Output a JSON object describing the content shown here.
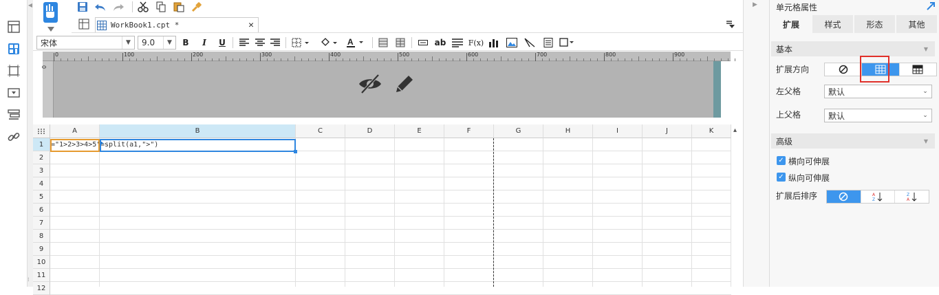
{
  "document": {
    "tab_label": "WorkBook1.cpt *"
  },
  "format": {
    "font_name": "宋体",
    "font_size": "9.0"
  },
  "format_buttons": {
    "bold": "B",
    "italic": "I",
    "underline": "U",
    "text_ab": "ab",
    "formula": "F(x)"
  },
  "ruler": {
    "ticks": [
      "0",
      "100",
      "200",
      "300",
      "400",
      "500",
      "600",
      "700",
      "800",
      "900"
    ],
    "vtick": "0"
  },
  "grid": {
    "columns": [
      "A",
      "B",
      "C",
      "D",
      "E",
      "F",
      "G",
      "H",
      "I",
      "J",
      "K"
    ],
    "rows": [
      "1",
      "2",
      "3",
      "4",
      "5",
      "6",
      "7",
      "8",
      "9",
      "10",
      "11",
      "12"
    ],
    "cells": {
      "A1": "=\"1>2>3>4>5\"",
      "B1": "=split(a1,\">\")"
    }
  },
  "panel": {
    "title": "单元格属性",
    "tabs": [
      "扩展",
      "样式",
      "形态",
      "其他"
    ],
    "basic_section": "基本",
    "expand_direction_label": "扩展方向",
    "left_parent_label": "左父格",
    "left_parent_value": "默认",
    "top_parent_label": "上父格",
    "top_parent_value": "默认",
    "advanced_section": "高级",
    "horizontal_expand_label": "横向可伸展",
    "vertical_expand_label": "纵向可伸展",
    "sort_after_expand_label": "扩展后排序"
  },
  "colors": {
    "accent": "#3d96ed",
    "highlight_box": "#e0302a",
    "header_band": "#b3b3b3",
    "teal_bar": "#6e9aa0"
  }
}
